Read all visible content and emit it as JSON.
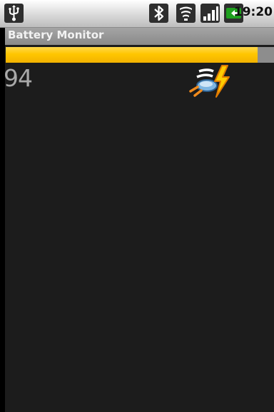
{
  "status_bar": {
    "time": "19:20",
    "icons": [
      "usb-icon",
      "bluetooth-icon",
      "wifi-icon",
      "signal-icon",
      "battery-charging-icon"
    ]
  },
  "app": {
    "title": "Battery Monitor"
  },
  "battery": {
    "level_text": "94",
    "level_fraction": 0.94,
    "status_icon": "charging-plug-icon"
  },
  "colors": {
    "progress_fill": "#ffc600",
    "progress_track": "#8d8d8d",
    "battery_green": "#1ea01e",
    "background": "#1c1c1c"
  }
}
